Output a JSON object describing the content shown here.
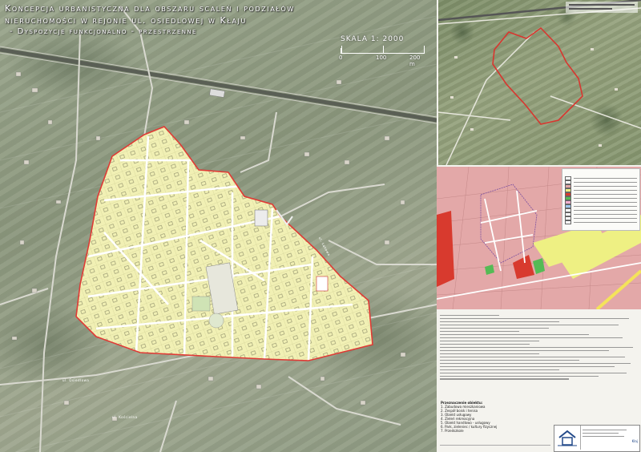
{
  "title": {
    "line1": "Koncepcja urbanistyczna dla obszaru scaleń i podziałów",
    "line2": "nieruchomości w rejonie ul. osiedlowej w Kłaju",
    "subtitle": "- Dyspozycje funkcjonalno - przestrzenne"
  },
  "scale": {
    "label": "SKALA 1: 2000",
    "ticks": [
      "0",
      "100",
      "200 m"
    ]
  },
  "colors": {
    "boundary": "#e03a35",
    "plots": "#f1f0b4",
    "plan_residential": "#e3a8a8",
    "plan_services": "#d83a2e",
    "plan_green": "#55bb55",
    "plan_agriculture": "#eef083"
  },
  "road_labels": [
    "ul. Osiedlowa",
    "ul. Łąkowa",
    "ul. Kościelna"
  ],
  "functions": {
    "heading": "Przeznaczenie obiektu:",
    "items": [
      "1. Zabudowa mieszkaniowa",
      "2. Zespół boisk i tenisa",
      "3. Obiekt usługowy",
      "4. Zieleń rekreacyjna",
      "5. Obiekt handlowo - usługowy",
      "6. Park, zieleniec / kultury fizycznej",
      "7. Przedszkole"
    ]
  },
  "title_box": {
    "place": "Kłaj"
  },
  "icons": [
    "house-logo-icon",
    "north-arrow-icon"
  ]
}
